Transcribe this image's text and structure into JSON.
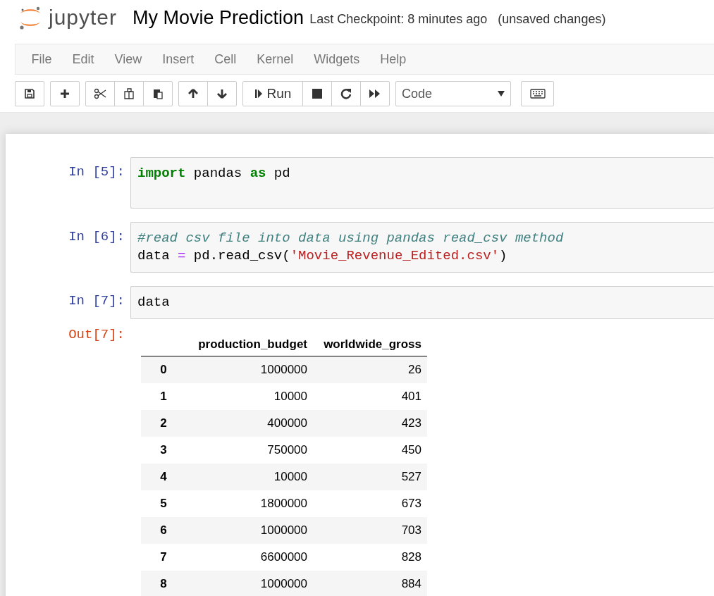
{
  "header": {
    "logo_text": "jupyter",
    "notebook_title": "My Movie Prediction",
    "checkpoint": "Last Checkpoint: 8 minutes ago",
    "save_status": "(unsaved changes)"
  },
  "menu": [
    "File",
    "Edit",
    "View",
    "Insert",
    "Cell",
    "Kernel",
    "Widgets",
    "Help"
  ],
  "toolbar": {
    "run_label": "Run",
    "cell_type": "Code"
  },
  "cells": [
    {
      "prompt": "In [5]:",
      "lines": [
        [
          {
            "kind": "keyword",
            "text": "import"
          },
          {
            "kind": "name",
            "text": " pandas "
          },
          {
            "kind": "keyword",
            "text": "as"
          },
          {
            "kind": "name",
            "text": " pd"
          }
        ]
      ],
      "tall": true
    },
    {
      "prompt": "In [6]:",
      "lines": [
        [
          {
            "kind": "comment",
            "text": "#read csv file into data using pandas read_csv method"
          }
        ],
        [
          {
            "kind": "name",
            "text": "data "
          },
          {
            "kind": "operator",
            "text": "="
          },
          {
            "kind": "name",
            "text": " pd.read_csv("
          },
          {
            "kind": "string",
            "text": "'Movie_Revenue_Edited.csv'"
          },
          {
            "kind": "name",
            "text": ")"
          }
        ]
      ],
      "tall": false
    },
    {
      "prompt": "In [7]:",
      "lines": [
        [
          {
            "kind": "name",
            "text": "data"
          }
        ]
      ],
      "tall": false
    }
  ],
  "output": {
    "prompt": "Out[7]:",
    "table": {
      "columns": [
        "production_budget",
        "worldwide_gross"
      ],
      "rows": [
        {
          "index": "0",
          "cells": [
            "1000000",
            "26"
          ]
        },
        {
          "index": "1",
          "cells": [
            "10000",
            "401"
          ]
        },
        {
          "index": "2",
          "cells": [
            "400000",
            "423"
          ]
        },
        {
          "index": "3",
          "cells": [
            "750000",
            "450"
          ]
        },
        {
          "index": "4",
          "cells": [
            "10000",
            "527"
          ]
        },
        {
          "index": "5",
          "cells": [
            "1800000",
            "673"
          ]
        },
        {
          "index": "6",
          "cells": [
            "1000000",
            "703"
          ]
        },
        {
          "index": "7",
          "cells": [
            "6600000",
            "828"
          ]
        },
        {
          "index": "8",
          "cells": [
            "1000000",
            "884"
          ]
        }
      ]
    }
  }
}
